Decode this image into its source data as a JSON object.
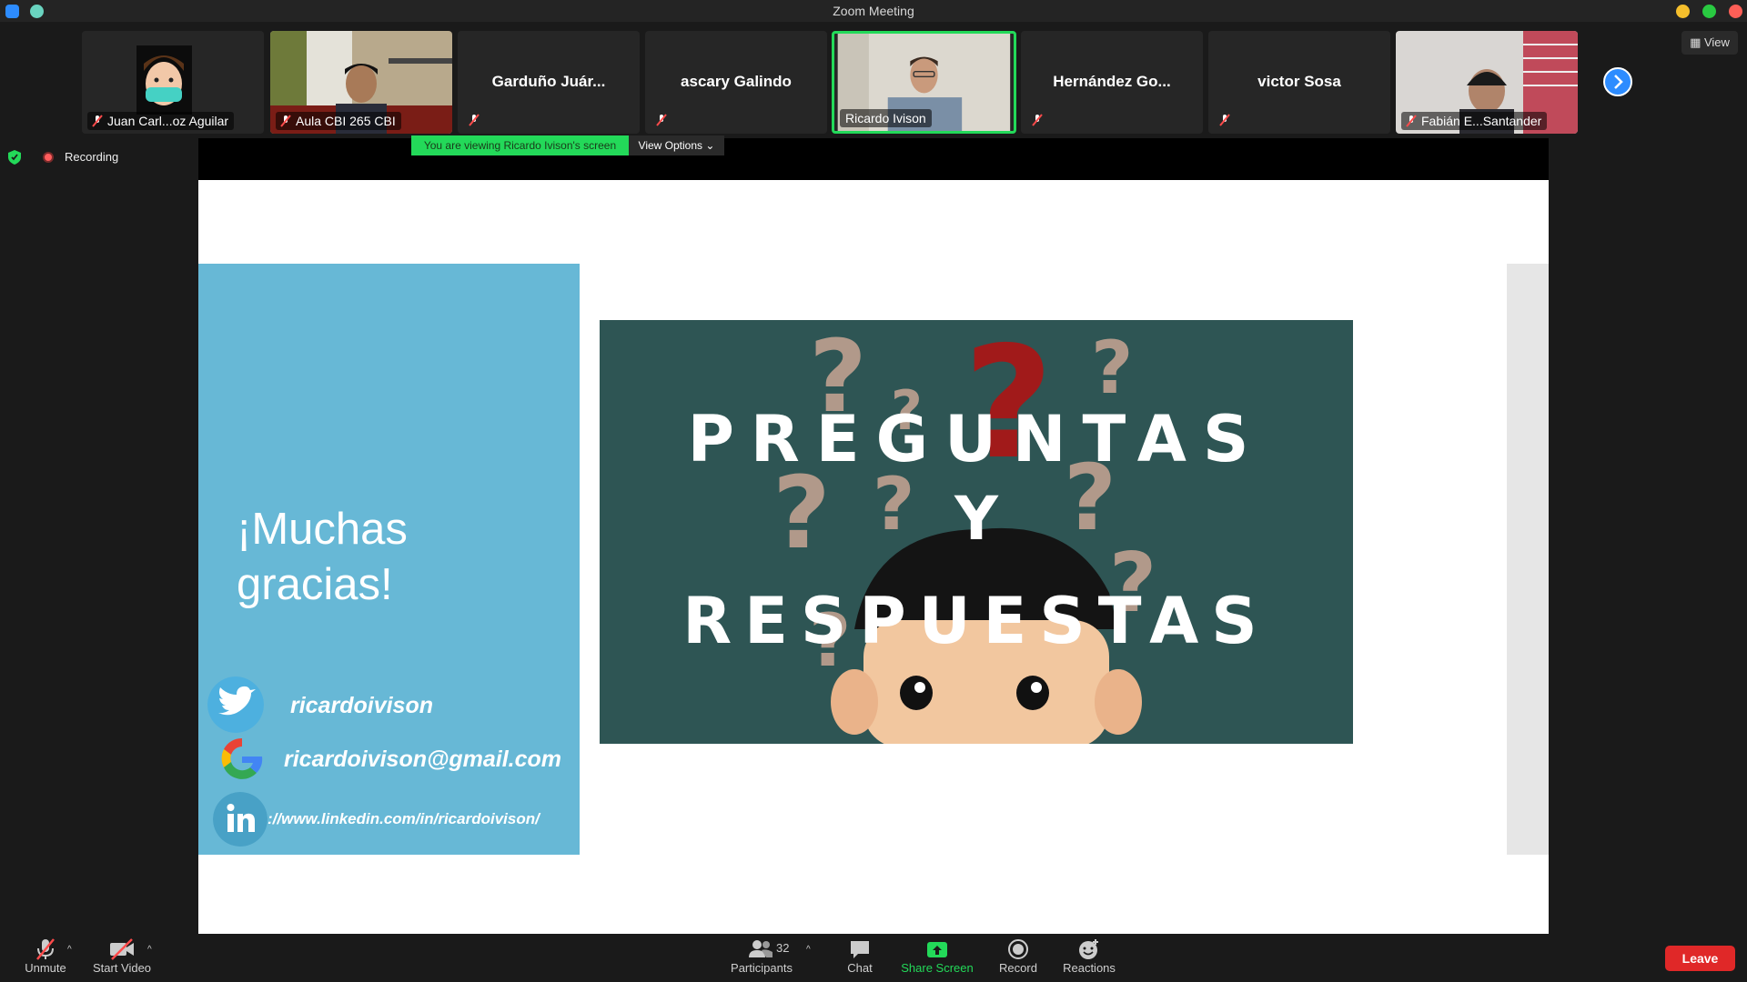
{
  "window": {
    "title": "Zoom Meeting"
  },
  "participants_strip": [
    {
      "name": "Juan Carl...oz Aguilar",
      "muted": true,
      "kind": "avatar"
    },
    {
      "name": "Aula CBI 265 CBI",
      "muted": true,
      "kind": "video"
    },
    {
      "name": "Garduño Juár...",
      "muted": true,
      "kind": "name-only"
    },
    {
      "name": "ascary Galindo",
      "muted": true,
      "kind": "name-only"
    },
    {
      "name": "Ricardo Ivison",
      "muted": false,
      "kind": "video",
      "active_speaker": true
    },
    {
      "name": "Hernández Go...",
      "muted": true,
      "kind": "name-only"
    },
    {
      "name": "victor Sosa",
      "muted": true,
      "kind": "name-only"
    },
    {
      "name": "Fabián E...Santander",
      "muted": true,
      "kind": "video"
    }
  ],
  "view_button": "View",
  "status": {
    "recording_label": "Recording",
    "viewing_banner": "You are viewing Ricardo Ivison's screen",
    "view_options": "View Options"
  },
  "slide": {
    "thanks_line1": "¡Muchas",
    "thanks_line2": "gracias!",
    "twitter": "ricardoivison",
    "email": "ricardoivison@gmail.com",
    "linkedin": "://www.linkedin.com/in/ricardoivison/",
    "qa_line1": "PREGUNTAS",
    "qa_line2": "Y",
    "qa_line3": "RESPUESTAS"
  },
  "toolbar": {
    "unmute": "Unmute",
    "start_video": "Start Video",
    "participants": "Participants",
    "participants_count": "32",
    "chat": "Chat",
    "share_screen": "Share Screen",
    "record": "Record",
    "reactions": "Reactions",
    "leave": "Leave"
  },
  "colors": {
    "accent_green": "#23d959",
    "zoom_blue": "#2d8cff",
    "leave_red": "#e02828",
    "slide_blue": "#67b8d6",
    "qa_background": "#2e5554"
  }
}
